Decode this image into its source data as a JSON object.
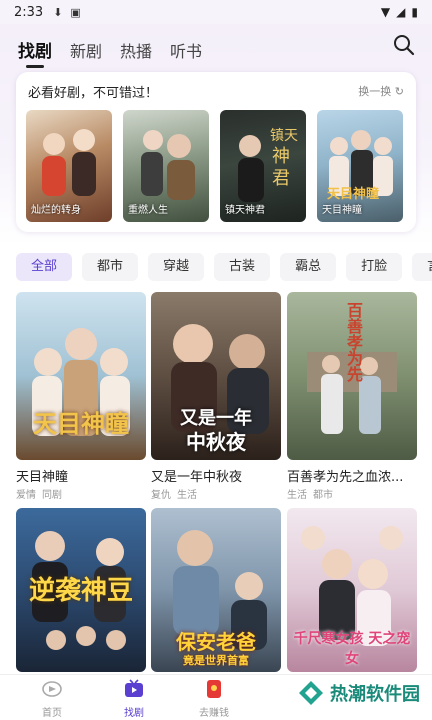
{
  "status_bar": {
    "time": "2:33"
  },
  "top_tabs": [
    "找剧",
    "新剧",
    "热播",
    "听书"
  ],
  "recommend": {
    "title": "必看好剧，不可错过！",
    "refresh_label": "换一换",
    "items": [
      "灿烂的转身",
      "重燃人生",
      "镇天神君",
      "天目神瞳"
    ]
  },
  "chips": [
    "全部",
    "都市",
    "穿越",
    "古装",
    "霸总",
    "打脸",
    "言"
  ],
  "dramas": [
    {
      "title": "天目神瞳",
      "tags": [
        "爱情",
        "同剧"
      ]
    },
    {
      "title": "又是一年中秋夜",
      "tags": [
        "复仇",
        "生活"
      ]
    },
    {
      "title": "百善孝为先之血浓...",
      "tags": [
        "生活",
        "都市"
      ]
    },
    {
      "title": "",
      "tags": []
    },
    {
      "title": "",
      "tags": []
    },
    {
      "title": "",
      "tags": []
    }
  ],
  "poster_text": {
    "p1": "天目神瞳",
    "p2a": "又是一年",
    "p2b": "中秋夜",
    "p3": "百善孝为先",
    "p4": "逆袭神豆",
    "p5a": "保安老爸",
    "p5b": "竟是世界首富",
    "p6": "千尺寒女孩 天之宠女"
  },
  "bottom_nav": [
    "首页",
    "找剧",
    "去赚钱"
  ],
  "watermark": "热潮软件园",
  "colors": {
    "accent": "#5a3fd0",
    "watermark": "#1a8a7a"
  }
}
